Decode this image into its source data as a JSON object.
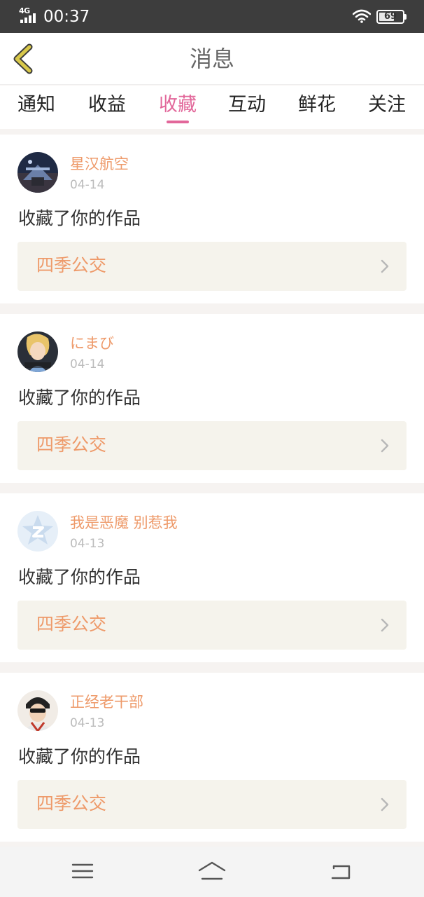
{
  "status_bar": {
    "network": "4G",
    "time": "00:37",
    "battery": "69",
    "battery_level": 0.69
  },
  "header": {
    "title": "消息",
    "back_icon": "chevron-left-icon",
    "back_color": "#d8c84a"
  },
  "tabs": [
    {
      "label": "通知",
      "active": false
    },
    {
      "label": "收益",
      "active": false
    },
    {
      "label": "收藏",
      "active": true
    },
    {
      "label": "互动",
      "active": false
    },
    {
      "label": "鲜花",
      "active": false
    },
    {
      "label": "关注",
      "active": false
    }
  ],
  "colors": {
    "accent": "#e2679a",
    "username": "#ee9a6a",
    "work_bg": "#f5f3ec"
  },
  "messages": [
    {
      "user": "星汉航空",
      "date": "04-14",
      "action": "收藏了你的作品",
      "work": "四季公交",
      "avatar": "photo-avatar"
    },
    {
      "user": "にまび",
      "date": "04-14",
      "action": "收藏了你的作品",
      "work": "四季公交",
      "avatar": "cartoon-avatar"
    },
    {
      "user": "我是恶魔 别惹我",
      "date": "04-13",
      "action": "收藏了你的作品",
      "work": "四季公交",
      "avatar": "default-qzone-avatar"
    },
    {
      "user": "正经老干部",
      "date": "04-13",
      "action": "收藏了你的作品",
      "work": "四季公交",
      "avatar": "person-avatar"
    }
  ],
  "nav_bar": {
    "icons": [
      "menu-icon",
      "home-icon",
      "back-icon"
    ]
  }
}
